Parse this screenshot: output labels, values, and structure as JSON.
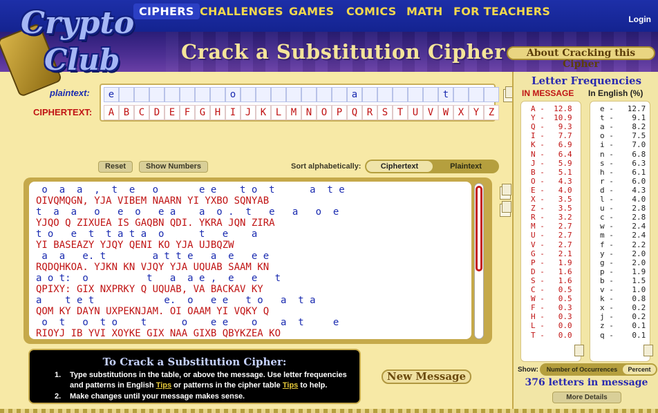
{
  "nav": {
    "items": [
      "CIPHERS",
      "CHALLENGES",
      "GAMES",
      "COMICS",
      "MATH",
      "FOR TEACHERS"
    ],
    "active": "CIPHERS",
    "login": "Login"
  },
  "logo": {
    "line1": "Crypto",
    "line2": "Club"
  },
  "header": {
    "title": "Crack a Substitution Cipher",
    "about_button": "About Cracking this Cipher"
  },
  "table": {
    "plaintext_label": "plaintext:",
    "ciphertext_label": "CIPHERTEXT:",
    "plaintext": [
      "e",
      "",
      "",
      "",
      "",
      "",
      "",
      "",
      "o",
      "",
      "",
      "",
      "",
      "",
      "",
      "",
      "a",
      "",
      "",
      "",
      "",
      "",
      "t",
      ""
    ],
    "ciphertext": [
      "A",
      "B",
      "C",
      "D",
      "E",
      "F",
      "G",
      "H",
      "I",
      "J",
      "K",
      "L",
      "M",
      "N",
      "O",
      "P",
      "Q",
      "R",
      "S",
      "T",
      "U",
      "V",
      "W",
      "X",
      "Y",
      "Z"
    ]
  },
  "controls": {
    "reset": "Reset",
    "show_numbers": "Show Numbers",
    "sort_label": "Sort alphabetically:",
    "sort_ciphertext": "Ciphertext",
    "sort_plaintext": "Plaintext"
  },
  "message": [
    {
      "plain": " o  a  a  ,  t  e   o       e e    t o  t      a  t e",
      "cipher": "OIVQMQGN, YJA VIBEM NAARN YI YXBO SQNYAB"
    },
    {
      "plain": "t  a  a   o   e  o   e a    a  o .  t   e   a   o  e",
      "cipher": "YJQO Q ZIXUEA IS GAQBN QDI. YKRA JQN ZIRA"
    },
    {
      "plain": "t o   e  t  t a t a  o      t   e    a",
      "cipher": "YI BASEAZY YJQY QENI KO YJA UJBQZW"
    },
    {
      "plain": " a  a   e. t        a t t e   a  e   e e",
      "cipher": "RQDQHKOA. YJKN KN VJQY YJA UQUAB SAAM KN"
    },
    {
      "plain": "a o t:  o          t   a  a e ,  e   e   t",
      "cipher": "QPIXY: GIX NXPRKY Q UQUAB, VA BACKAV KY"
    },
    {
      "plain": "a    t e t            e.  o   e e   t o   a  t a",
      "cipher": "QOM KY DAYN UXPEKNJAM. OI OAAM YI VQKY Q"
    },
    {
      "plain": " o  t   o  t o    t      o    e e    o    a  t     e",
      "cipher": "RIOYJ IB YVI XOYKE GIX NAA GIXB QBYKZEA KO"
    }
  ],
  "instructions": {
    "title": "To Crack a Substitution Cipher:",
    "step1_a": "Type substitutions in the table, or above the message. Use letter frequencies",
    "step1_b": "and patterns in English ",
    "step1_tip1": "Tips",
    "step1_c": " or patterns in the cipher table ",
    "step1_tip2": "Tips",
    "step1_d": " to help.",
    "step2": "Make changes until your message makes sense."
  },
  "new_message": "New Message",
  "frequencies": {
    "title": "Letter Frequencies",
    "in_message_label": "IN MESSAGE",
    "in_english_label": "In English (%)",
    "in_message": [
      [
        "A",
        "12.8"
      ],
      [
        "Y",
        "10.9"
      ],
      [
        "Q",
        "9.3"
      ],
      [
        "I",
        "7.7"
      ],
      [
        "K",
        "6.9"
      ],
      [
        "N",
        "6.4"
      ],
      [
        "J",
        "5.9"
      ],
      [
        "B",
        "5.1"
      ],
      [
        "O",
        "4.3"
      ],
      [
        "E",
        "4.0"
      ],
      [
        "X",
        "3.5"
      ],
      [
        "Z",
        "3.5"
      ],
      [
        "R",
        "3.2"
      ],
      [
        "M",
        "2.7"
      ],
      [
        "U",
        "2.7"
      ],
      [
        "V",
        "2.7"
      ],
      [
        "G",
        "2.1"
      ],
      [
        "P",
        "1.9"
      ],
      [
        "D",
        "1.6"
      ],
      [
        "S",
        "1.6"
      ],
      [
        "C",
        "0.5"
      ],
      [
        "W",
        "0.5"
      ],
      [
        "F",
        "0.3"
      ],
      [
        "H",
        "0.3"
      ],
      [
        "L",
        "0.0"
      ],
      [
        "T",
        "0.0"
      ]
    ],
    "in_english": [
      [
        "e",
        "12.7"
      ],
      [
        "t",
        "9.1"
      ],
      [
        "a",
        "8.2"
      ],
      [
        "o",
        "7.5"
      ],
      [
        "i",
        "7.0"
      ],
      [
        "n",
        "6.8"
      ],
      [
        "s",
        "6.3"
      ],
      [
        "h",
        "6.1"
      ],
      [
        "r",
        "6.0"
      ],
      [
        "d",
        "4.3"
      ],
      [
        "l",
        "4.0"
      ],
      [
        "u",
        "2.8"
      ],
      [
        "c",
        "2.8"
      ],
      [
        "w",
        "2.4"
      ],
      [
        "m",
        "2.4"
      ],
      [
        "f",
        "2.2"
      ],
      [
        "y",
        "2.0"
      ],
      [
        "g",
        "2.0"
      ],
      [
        "p",
        "1.9"
      ],
      [
        "b",
        "1.5"
      ],
      [
        "v",
        "1.0"
      ],
      [
        "k",
        "0.8"
      ],
      [
        "x",
        "0.2"
      ],
      [
        "j",
        "0.2"
      ],
      [
        "z",
        "0.1"
      ],
      [
        "q",
        "0.1"
      ]
    ],
    "show_label": "Show:",
    "show_occurrences": "Number of Occurrences",
    "show_percent": "Percent",
    "count_text": "376 letters in message",
    "more_details": "More Details"
  }
}
